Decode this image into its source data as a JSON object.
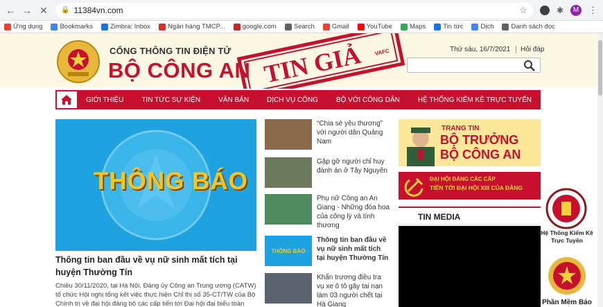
{
  "browser": {
    "url": "11384vn.com",
    "back_icon": "back-arrow-icon",
    "bookmarks": [
      {
        "label": "Ứng dụng",
        "color": "#ea4335"
      },
      {
        "label": "Bookmarks",
        "color": "#4285f4"
      },
      {
        "label": "Zimbra: Inbox",
        "color": "#1a73e8"
      },
      {
        "label": "Ngân hàng TMCP...",
        "color": "#d93025"
      },
      {
        "label": "google.com",
        "color": "#c62828"
      },
      {
        "label": "Search",
        "color": "#5f6368"
      },
      {
        "label": "Gmail",
        "color": "#ea4335"
      },
      {
        "label": "YouTube",
        "color": "#ff0000"
      },
      {
        "label": "Maps",
        "color": "#34a853"
      },
      {
        "label": "Tin tức",
        "color": "#1a73e8"
      },
      {
        "label": "Dịch",
        "color": "#4285f4"
      },
      {
        "label": "Danh sách đọc",
        "color": "#5f6368"
      }
    ],
    "avatar": "M"
  },
  "header": {
    "subtitle": "CỔNG THÔNG TIN ĐIỆN TỬ",
    "title": "BỘ CÔNG AN",
    "date": "Thứ sáu, 16/7/2021",
    "help": "Hỏi đáp",
    "stamp_text": "TIN GIẢ",
    "stamp_tag": "VAFC"
  },
  "nav": {
    "items": [
      "GIỚI THIỆU",
      "TIN TỨC SỰ KIỆN",
      "VĂN BẢN",
      "DỊCH VỤ CÔNG",
      "BỘ VỚI CÔNG DÂN",
      "HỆ THỐNG KIỂM KÊ TRỰC TUYẾN"
    ]
  },
  "main": {
    "hero_text": "THÔNG BÁO",
    "title": "Thông tin ban đầu về vụ nữ sinh mất tích tại huyện Thường Tín",
    "summary": "Chiều 30/11/2020, tại Hà Nội, Đảng ủy Công an Trung ương (CATW) tổ chức Hội nghị tổng kết việc thực hiện Chỉ thị số 35-CT/TW của Bộ Chính trị về đại hội đảng bộ các cấp tiến tới Đại hội đại biểu toàn quốc lần thứ"
  },
  "news": [
    {
      "text": "“Chia sẻ yêu thương” với người dân Quảng Nam",
      "bold": false
    },
    {
      "text": "Gặp gỡ người chỉ huy đánh án ở Tây Nguyên",
      "bold": false
    },
    {
      "text": "Phụ nữ Công an An Giang - Những đóa hoa của công lý và tình thương",
      "bold": false
    },
    {
      "text": "Thông tin ban đầu về vụ nữ sinh mất tích tại huyện Thường Tín",
      "bold": true
    },
    {
      "text": "Khẩn trương điều tra vụ xe ô tô gây tai nạn làm 03 người chết tại Hà Giang",
      "bold": false
    }
  ],
  "right": {
    "banner1_top": "TRANG TIN",
    "banner1_main": "BỘ TRƯỞNG BỘ CÔNG AN",
    "banner2_line1": "ĐẠI HỘI ĐẢNG CÁC CẤP",
    "banner2_line2": "TIẾN TỚI ĐẠI HỘI XIII CỦA ĐẢNG",
    "media_title": "TIN MEDIA"
  },
  "side": {
    "item1": "Hệ Thống Kiểm Kê Trực Tuyến",
    "item2": "Phần Mềm Bảo Mật"
  }
}
